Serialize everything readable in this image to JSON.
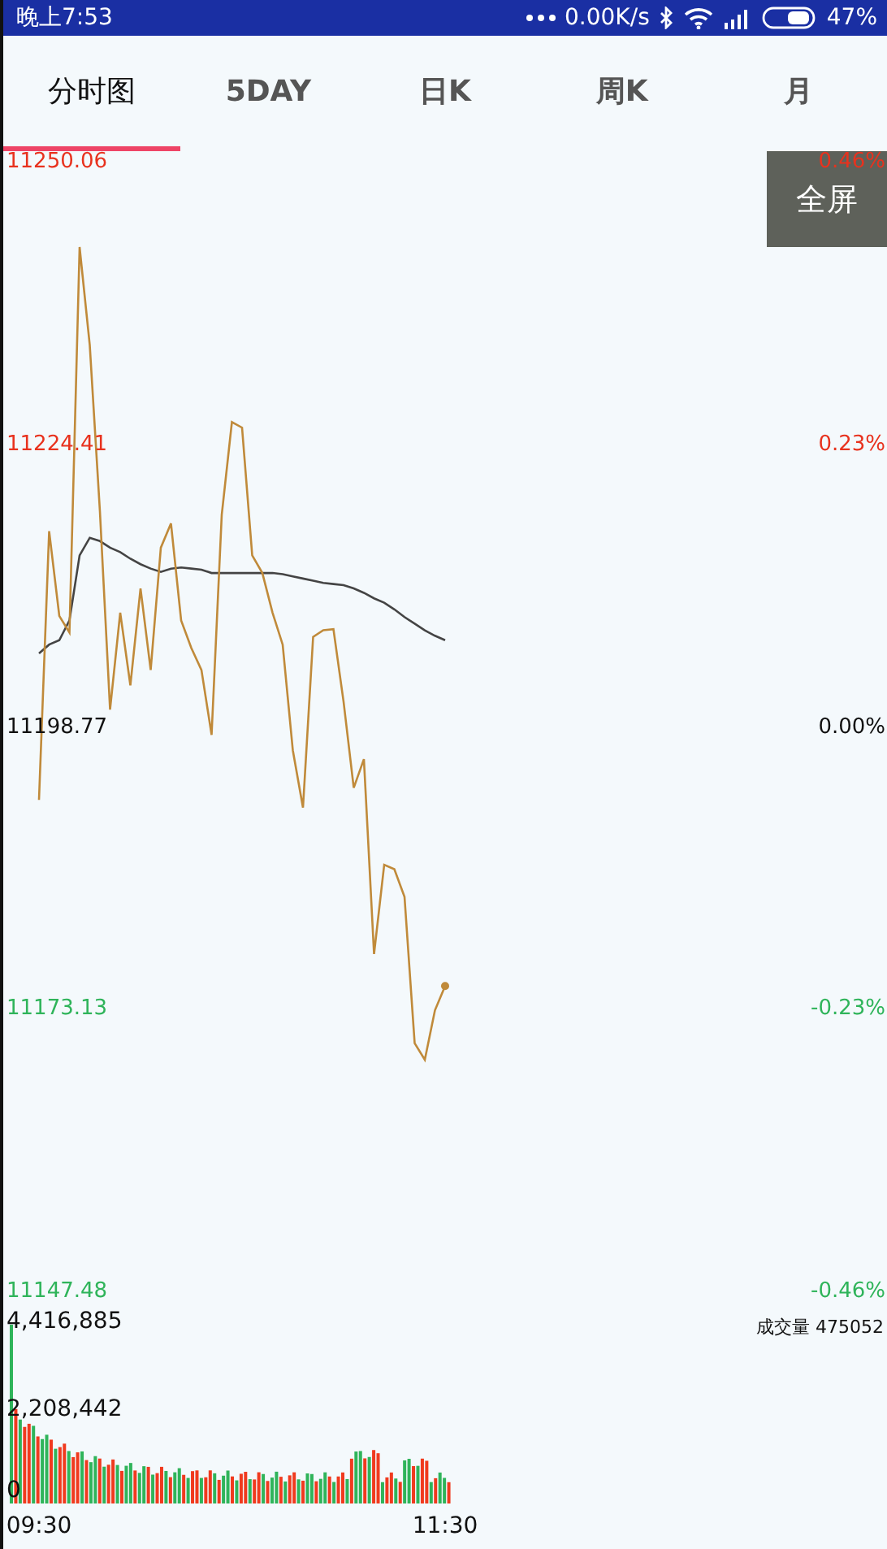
{
  "status_bar": {
    "time": "晚上7:53",
    "network_speed": "0.00K/s",
    "battery": "47%"
  },
  "tabs": [
    {
      "label": "分时图",
      "selected": true
    },
    {
      "label": "5DAY",
      "selected": false
    },
    {
      "label": "日K",
      "selected": false
    },
    {
      "label": "周K",
      "selected": false
    },
    {
      "label": "月",
      "selected": false
    }
  ],
  "fullscreen_button": "全屏",
  "price_chart": {
    "chart_data": {
      "type": "line",
      "x": [
        9.5,
        9.55,
        9.6,
        9.65,
        9.7,
        9.75,
        9.8,
        9.85,
        9.9,
        9.95,
        10.0,
        10.05,
        10.1,
        10.15,
        10.2,
        10.25,
        10.3,
        10.35,
        10.4,
        10.45,
        10.5,
        10.55,
        10.6,
        10.65,
        10.7,
        10.75,
        10.8,
        10.85,
        10.9,
        10.95,
        11.0,
        11.05,
        11.1,
        11.15,
        11.2,
        11.25,
        11.3,
        11.35,
        11.4,
        11.45,
        11.5
      ],
      "series": [
        {
          "color": "#c08a3a",
          "values": [
            11192.2,
            11216.6,
            11208.9,
            11207.4,
            11242.4,
            11233.5,
            11218.4,
            11200.4,
            11209.2,
            11202.6,
            11211.4,
            11204.0,
            11215.1,
            11217.3,
            11208.5,
            11206.0,
            11204.0,
            11198.1,
            11218.1,
            11226.5,
            11226.0,
            11214.4,
            11212.8,
            11209.2,
            11206.3,
            11196.7,
            11191.5,
            11207.0,
            11207.6,
            11207.7,
            11201.1,
            11193.3,
            11195.9,
            11178.2,
            11186.3,
            11185.9,
            11183.4,
            11170.1,
            11168.6,
            11173.1,
            11175.3
          ]
        },
        {
          "color": "#444444",
          "values": [
            11205.5,
            11206.3,
            11206.7,
            11208.5,
            11214.4,
            11216.0,
            11215.7,
            11215.1,
            11214.7,
            11214.1,
            11213.6,
            11213.2,
            11212.9,
            11213.2,
            11213.3,
            11213.2,
            11213.1,
            11212.8,
            11212.8,
            11212.8,
            11212.8,
            11212.8,
            11212.8,
            11212.8,
            11212.7,
            11212.5,
            11212.3,
            11212.1,
            11211.9,
            11211.8,
            11211.7,
            11211.4,
            11211.0,
            11210.5,
            11210.1,
            11209.5,
            11208.8,
            11208.2,
            11207.6,
            11207.1,
            11206.7
          ]
        }
      ],
      "xlim": [
        9.5,
        11.5
      ],
      "ylim": [
        11147.48,
        11250.06
      ],
      "xticks": [
        {
          "value": 9.5,
          "label": "09:30"
        },
        {
          "value": 11.5,
          "label": "11:30"
        }
      ],
      "yticks": [
        {
          "value": 11250.06,
          "label": "11250.06"
        },
        {
          "value": 11224.41,
          "label": "11224.41"
        },
        {
          "value": 11198.77,
          "label": "11198.77"
        },
        {
          "value": 11173.13,
          "label": "11173.13"
        },
        {
          "value": 11147.48,
          "label": "11147.48"
        }
      ]
    }
  },
  "percent_axis": [
    {
      "label": "0.46%",
      "color": "#e8321e"
    },
    {
      "label": "0.23%",
      "color": "#e8321e"
    },
    {
      "label": "0.00%",
      "color": "#111111"
    },
    {
      "label": "-0.23%",
      "color": "#2fb45a"
    },
    {
      "label": "-0.46%",
      "color": "#2fb45a"
    }
  ],
  "volume_axis": [
    "4,416,885",
    "2,208,442",
    "0"
  ],
  "volume_label": "成交量 475052"
}
